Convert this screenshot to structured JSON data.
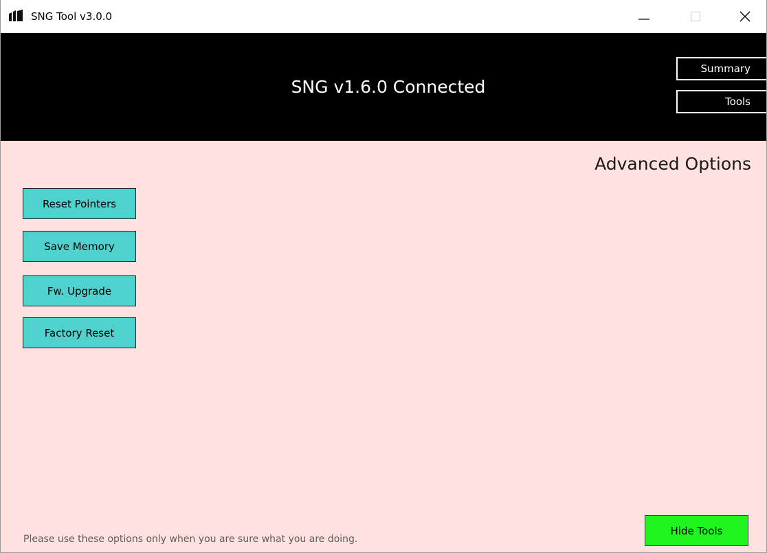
{
  "window": {
    "title": "SNG Tool v3.0.0",
    "icon": "sng-logo-icon",
    "controls": [
      "minimize-icon",
      "maximize-icon",
      "close-icon"
    ]
  },
  "header": {
    "status_text": "SNG v1.6.0 Connected",
    "nav": {
      "summary_label": "Summary",
      "tools_label": "Tools"
    }
  },
  "main": {
    "section_title": "Advanced Options",
    "actions": [
      {
        "label": "Reset Pointers"
      },
      {
        "label": "Save Memory"
      },
      {
        "label": "Fw. Upgrade"
      },
      {
        "label": "Factory Reset"
      }
    ],
    "warning_text": "Please use these options only when you are sure what you are doing.",
    "hide_tools_label": "Hide Tools"
  },
  "colors": {
    "header_bg": "#000000",
    "content_bg": "#ffe1df",
    "action_button": "#4fd1cd",
    "hide_button": "#1ff51f"
  }
}
